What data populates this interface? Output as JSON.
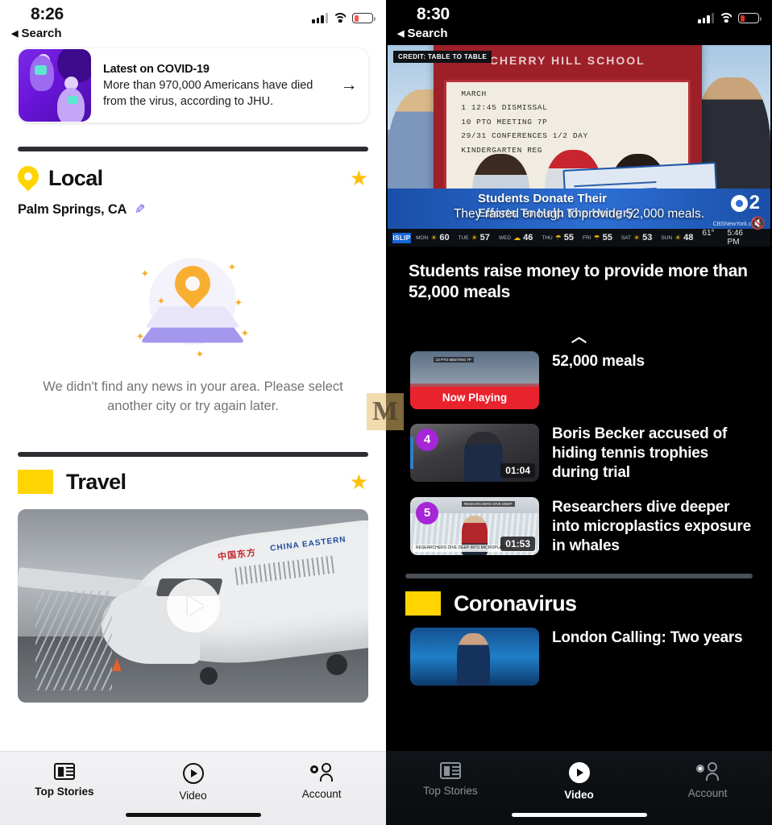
{
  "left": {
    "status": {
      "time": "8:26",
      "back_label": "Search",
      "back_icon": "left-triangle-icon"
    },
    "covid_card": {
      "title": "Latest on COVID-19",
      "summary": "More than 970,000 Americans have died from the virus, according to JHU.",
      "arrow": "→"
    },
    "local": {
      "title": "Local",
      "pin_icon": "location-pin-icon",
      "star_icon": "star-icon",
      "star": "★",
      "city": "Palm Springs, CA",
      "edit_icon": "pencil-icon",
      "edit_glyph": "✎",
      "empty_message": "We didn't find any news in your area. Please select another city or try again later."
    },
    "travel": {
      "title": "Travel",
      "star": "★",
      "play_icon": "play-button-icon"
    },
    "tabs": [
      {
        "label": "Top Stories",
        "icon": "news-icon",
        "active": true
      },
      {
        "label": "Video",
        "icon": "video-play-icon",
        "active": false
      },
      {
        "label": "Account",
        "icon": "account-gear-icon",
        "active": false
      }
    ]
  },
  "right": {
    "status": {
      "time": "8:30",
      "back_label": "Search",
      "back_icon": "left-triangle-icon"
    },
    "player": {
      "credit": "CREDIT: TABLE TO TABLE",
      "sign_name": "CHERRY HILL SCHOOL",
      "sign_lines": [
        "MARCH",
        "1  12:45 DISMISSAL",
        "10 PTO MEETING 7P",
        "29/31 CONFERENCES 1/2 DAY",
        "KINDERGARTEN REG"
      ],
      "lower_third_line1": "Students Donate Their",
      "lower_third_line2": "Efforts To Help The Hungry",
      "caption": "They raised enough to provide 52,000 meals.",
      "network": "2",
      "network_sub": "CBSNewYork.com",
      "mute_icon": "mute-speaker-icon",
      "ticker": {
        "city": "ISLIP",
        "days": [
          {
            "day": "MON",
            "temp": "60"
          },
          {
            "day": "TUE",
            "temp": "57"
          },
          {
            "day": "WED",
            "temp": "46"
          },
          {
            "day": "THU",
            "temp": "55"
          },
          {
            "day": "FRI",
            "temp": "55"
          },
          {
            "day": "SAT",
            "temp": "53"
          },
          {
            "day": "SUN",
            "temp": "48"
          }
        ],
        "current_temp": "61°",
        "clock": "5:46 PM"
      }
    },
    "headline": "Students raise money to provide more than 52,000 meals",
    "collapse_icon": "chevron-up-icon",
    "collapse_glyph": "︿",
    "playlist": [
      {
        "badge": "",
        "now_playing": "Now Playing",
        "duration": "",
        "title": "52,000 meals"
      },
      {
        "badge": "4",
        "now_playing": "",
        "duration": "01:04",
        "title": "Boris Becker accused of hiding tennis trophies during trial"
      },
      {
        "badge": "5",
        "now_playing": "",
        "duration": "01:53",
        "title": "Researchers dive deeper into microplastics exposure in whales"
      }
    ],
    "coronavirus": {
      "title": "Coronavirus",
      "item_title": "London Calling: Two years"
    },
    "tabs": [
      {
        "label": "Top Stories",
        "icon": "news-icon",
        "active": false
      },
      {
        "label": "Video",
        "icon": "video-play-icon",
        "active": true
      },
      {
        "label": "Account",
        "icon": "account-gear-icon",
        "active": false
      }
    ]
  },
  "watermark": {
    "text": "M"
  },
  "colors": {
    "accent_yellow": "#ffd400",
    "star": "#ffc107",
    "purple_badge": "#a626d8",
    "now_playing_red": "#e8232e",
    "link_purple": "#6c4ee8"
  }
}
